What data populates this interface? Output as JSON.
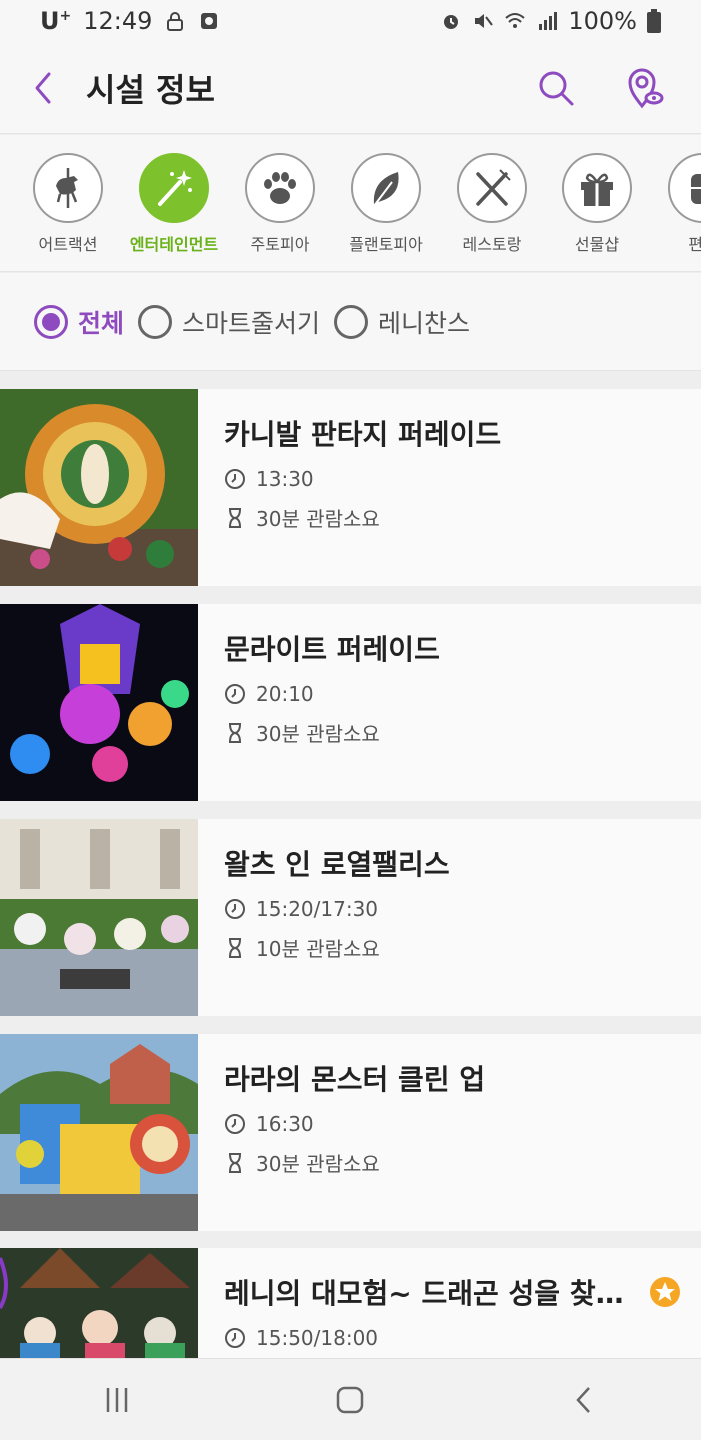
{
  "status": {
    "carrier": "U",
    "carrier_sup": "+",
    "time": "12:49",
    "battery": "100%"
  },
  "app_bar": {
    "title": "시설 정보",
    "back_icon": "chevron-left-icon",
    "search_icon": "search-icon",
    "map_icon": "map-pin-icon"
  },
  "categories": [
    {
      "label": "어트랙션",
      "icon": "carousel-horse-icon",
      "active": false
    },
    {
      "label": "엔터테인먼트",
      "icon": "magic-wand-icon",
      "active": true
    },
    {
      "label": "주토피아",
      "icon": "paw-icon",
      "active": false
    },
    {
      "label": "플랜토피아",
      "icon": "leaf-icon",
      "active": false
    },
    {
      "label": "레스토랑",
      "icon": "fork-knife-icon",
      "active": false
    },
    {
      "label": "선물샵",
      "icon": "gift-icon",
      "active": false
    },
    {
      "label": "편의",
      "icon": "convenience-icon",
      "active": false
    }
  ],
  "filters": [
    {
      "label": "전체",
      "checked": true
    },
    {
      "label": "스마트줄서기",
      "checked": false
    },
    {
      "label": "레니찬스",
      "checked": false
    }
  ],
  "items": [
    {
      "title": "카니발 판타지 퍼레이드",
      "time": "13:30",
      "duration": "30분 관람소요",
      "favorite": false
    },
    {
      "title": "문라이트 퍼레이드",
      "time": "20:10",
      "duration": "30분 관람소요",
      "favorite": false
    },
    {
      "title": "왈츠 인 로열팰리스",
      "time": "15:20/17:30",
      "duration": "10분 관람소요",
      "favorite": false
    },
    {
      "title": "라라의 몬스터 클린 업",
      "time": "16:30",
      "duration": "30분 관람소요",
      "favorite": false
    },
    {
      "title": "레니의 대모험~ 드래곤 성을 찾아서",
      "time": "15:50/18:00",
      "duration": "",
      "favorite": true
    }
  ],
  "colors": {
    "accent": "#8e4bbf",
    "active_green": "#7dc22c"
  }
}
